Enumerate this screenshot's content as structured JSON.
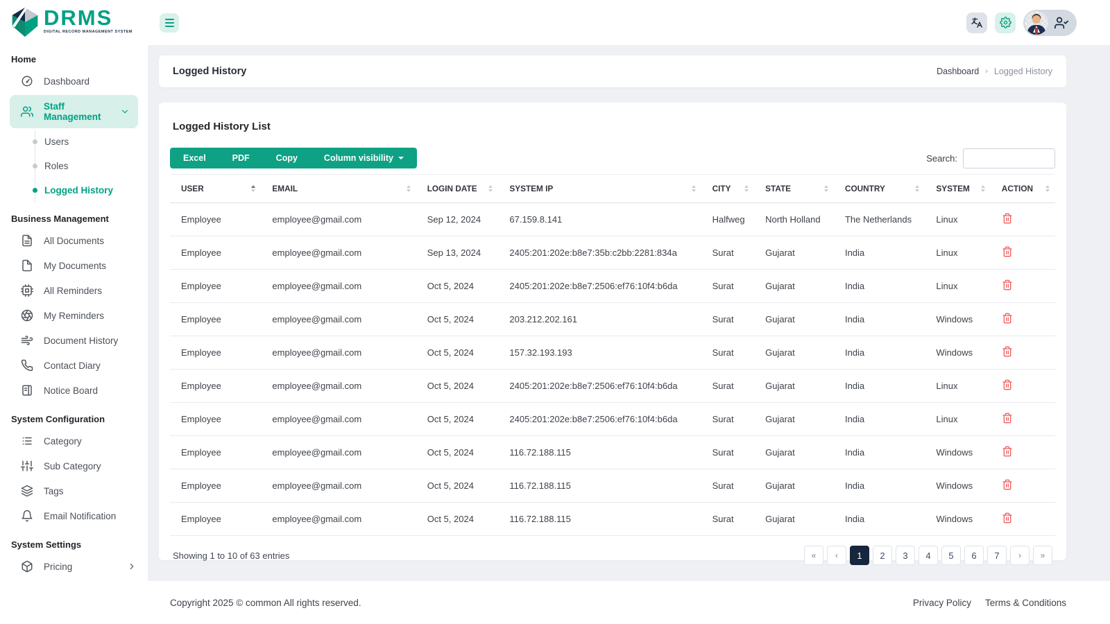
{
  "app": {
    "name": "DRMS",
    "tagline": "DIGITAL RECORD MANAGEMENT SYSTEM"
  },
  "topbar": {
    "icons": [
      "translate-icon",
      "gear-icon",
      "avatar",
      "user-check-icon"
    ]
  },
  "sidebar": {
    "sections": [
      {
        "label": "Home",
        "items": [
          {
            "icon": "dashboard-icon",
            "label": "Dashboard"
          },
          {
            "icon": "staff-icon",
            "label": "Staff Management",
            "active_parent": true,
            "chevron": "down",
            "children": [
              {
                "label": "Users"
              },
              {
                "label": "Roles"
              },
              {
                "label": "Logged History",
                "active": true
              }
            ]
          }
        ]
      },
      {
        "label": "Business Management",
        "items": [
          {
            "icon": "file-text-icon",
            "label": "All Documents"
          },
          {
            "icon": "file-icon",
            "label": "My Documents"
          },
          {
            "icon": "cpu-icon",
            "label": "All Reminders"
          },
          {
            "icon": "aperture-icon",
            "label": "My Reminders"
          },
          {
            "icon": "wind-icon",
            "label": "Document History"
          },
          {
            "icon": "phone-icon",
            "label": "Contact Diary"
          },
          {
            "icon": "board-icon",
            "label": "Notice Board"
          }
        ]
      },
      {
        "label": "System Configuration",
        "items": [
          {
            "icon": "list-icon",
            "label": "Category"
          },
          {
            "icon": "sliders-icon",
            "label": "Sub Category"
          },
          {
            "icon": "layers-icon",
            "label": "Tags"
          },
          {
            "icon": "bell-icon",
            "label": "Email Notification"
          }
        ]
      },
      {
        "label": "System Settings",
        "items": [
          {
            "icon": "package-icon",
            "label": "Pricing",
            "chevron": "right"
          }
        ]
      }
    ]
  },
  "page": {
    "title": "Logged History",
    "breadcrumb": [
      "Dashboard",
      "Logged History"
    ]
  },
  "card": {
    "title": "Logged History List",
    "buttons": [
      "Excel",
      "PDF",
      "Copy",
      "Column visibility"
    ],
    "search_label": "Search:",
    "search_value": "",
    "table": {
      "columns": [
        {
          "label": "USER",
          "sort": "asc"
        },
        {
          "label": "EMAIL",
          "sort": "none"
        },
        {
          "label": "LOGIN DATE",
          "sort": "none"
        },
        {
          "label": "SYSTEM IP",
          "sort": "none"
        },
        {
          "label": "CITY",
          "sort": "none"
        },
        {
          "label": "STATE",
          "sort": "none"
        },
        {
          "label": "COUNTRY",
          "sort": "none"
        },
        {
          "label": "SYSTEM",
          "sort": "none"
        },
        {
          "label": "ACTION",
          "sort": "none"
        }
      ],
      "rows": [
        {
          "user": "Employee",
          "email": "employee@gmail.com",
          "login_date": "Sep 12, 2024",
          "system_ip": "67.159.8.141",
          "city": "Halfweg",
          "state": "North Holland",
          "country": "The Netherlands",
          "system": "Linux"
        },
        {
          "user": "Employee",
          "email": "employee@gmail.com",
          "login_date": "Sep 13, 2024",
          "system_ip": "2405:201:202e:b8e7:35b:c2bb:2281:834a",
          "city": "Surat",
          "state": "Gujarat",
          "country": "India",
          "system": "Linux"
        },
        {
          "user": "Employee",
          "email": "employee@gmail.com",
          "login_date": "Oct 5, 2024",
          "system_ip": "2405:201:202e:b8e7:2506:ef76:10f4:b6da",
          "city": "Surat",
          "state": "Gujarat",
          "country": "India",
          "system": "Linux"
        },
        {
          "user": "Employee",
          "email": "employee@gmail.com",
          "login_date": "Oct 5, 2024",
          "system_ip": "203.212.202.161",
          "city": "Surat",
          "state": "Gujarat",
          "country": "India",
          "system": "Windows"
        },
        {
          "user": "Employee",
          "email": "employee@gmail.com",
          "login_date": "Oct 5, 2024",
          "system_ip": "157.32.193.193",
          "city": "Surat",
          "state": "Gujarat",
          "country": "India",
          "system": "Windows"
        },
        {
          "user": "Employee",
          "email": "employee@gmail.com",
          "login_date": "Oct 5, 2024",
          "system_ip": "2405:201:202e:b8e7:2506:ef76:10f4:b6da",
          "city": "Surat",
          "state": "Gujarat",
          "country": "India",
          "system": "Linux"
        },
        {
          "user": "Employee",
          "email": "employee@gmail.com",
          "login_date": "Oct 5, 2024",
          "system_ip": "2405:201:202e:b8e7:2506:ef76:10f4:b6da",
          "city": "Surat",
          "state": "Gujarat",
          "country": "India",
          "system": "Linux"
        },
        {
          "user": "Employee",
          "email": "employee@gmail.com",
          "login_date": "Oct 5, 2024",
          "system_ip": "116.72.188.115",
          "city": "Surat",
          "state": "Gujarat",
          "country": "India",
          "system": "Windows"
        },
        {
          "user": "Employee",
          "email": "employee@gmail.com",
          "login_date": "Oct 5, 2024",
          "system_ip": "116.72.188.115",
          "city": "Surat",
          "state": "Gujarat",
          "country": "India",
          "system": "Windows"
        },
        {
          "user": "Employee",
          "email": "employee@gmail.com",
          "login_date": "Oct 5, 2024",
          "system_ip": "116.72.188.115",
          "city": "Surat",
          "state": "Gujarat",
          "country": "India",
          "system": "Windows"
        }
      ]
    },
    "showing": "Showing 1 to 10 of 63 entries",
    "pagination": [
      {
        "label": "«"
      },
      {
        "label": "‹"
      },
      {
        "label": "1",
        "active": true
      },
      {
        "label": "2"
      },
      {
        "label": "3"
      },
      {
        "label": "4"
      },
      {
        "label": "5"
      },
      {
        "label": "6"
      },
      {
        "label": "7"
      },
      {
        "label": "›"
      },
      {
        "label": "»"
      }
    ]
  },
  "footer": {
    "copyright": "Copyright 2025 © common All rights reserved.",
    "links": [
      "Privacy Policy",
      "Terms & Conditions"
    ]
  },
  "colors": {
    "accent_teal": "#0FA184",
    "accent_teal_text": "#00A183",
    "light_teal_bg": "#D7F0E9",
    "navy": "#15263D",
    "danger_red": "#F25C5C",
    "content_bg": "#EEF0F4"
  }
}
